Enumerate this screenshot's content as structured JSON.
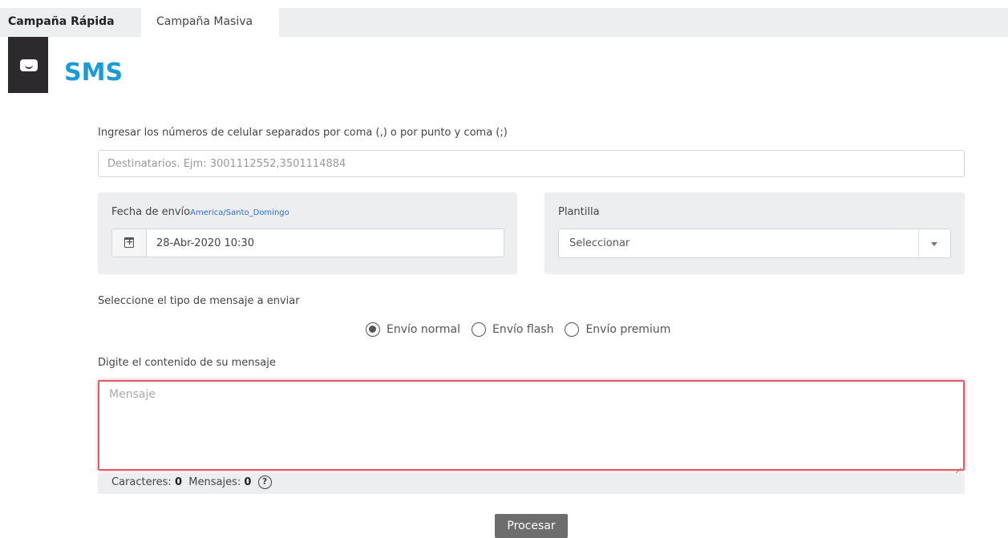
{
  "tabs": {
    "quick": "Campaña Rápida",
    "bulk": "Campaña Masiva"
  },
  "header": {
    "title": "SMS",
    "icon": "message-icon"
  },
  "recipients": {
    "label": "Ingresar los números de celular separados por coma (,) o por punto y coma (;)",
    "placeholder": "Destinatarios. Ejm: 3001112552,3501114884"
  },
  "send_date": {
    "label": "Fecha de envío",
    "timezone": "America/Santo_Domingo",
    "value": "28-Abr-2020 10:30",
    "icon": "calendar-icon"
  },
  "template": {
    "label": "Plantilla",
    "selected": "Seleccionar"
  },
  "message_type": {
    "label": "Seleccione el tipo de mensaje a enviar",
    "options": [
      "Envío normal",
      "Envío flash",
      "Envío premium"
    ],
    "selected": "Envío normal"
  },
  "message": {
    "label": "Digite el contenido de su mensaje",
    "placeholder": "Mensaje",
    "value": ""
  },
  "counters": {
    "chars_label": "Caracteres:",
    "chars": "0",
    "msgs_label": "Mensajes:",
    "msgs": "0",
    "help": "?"
  },
  "submit_label": "Procesar",
  "colors": {
    "accent": "#1a9bd7",
    "error_border": "#e45a64",
    "button": "#6d6d6d"
  }
}
